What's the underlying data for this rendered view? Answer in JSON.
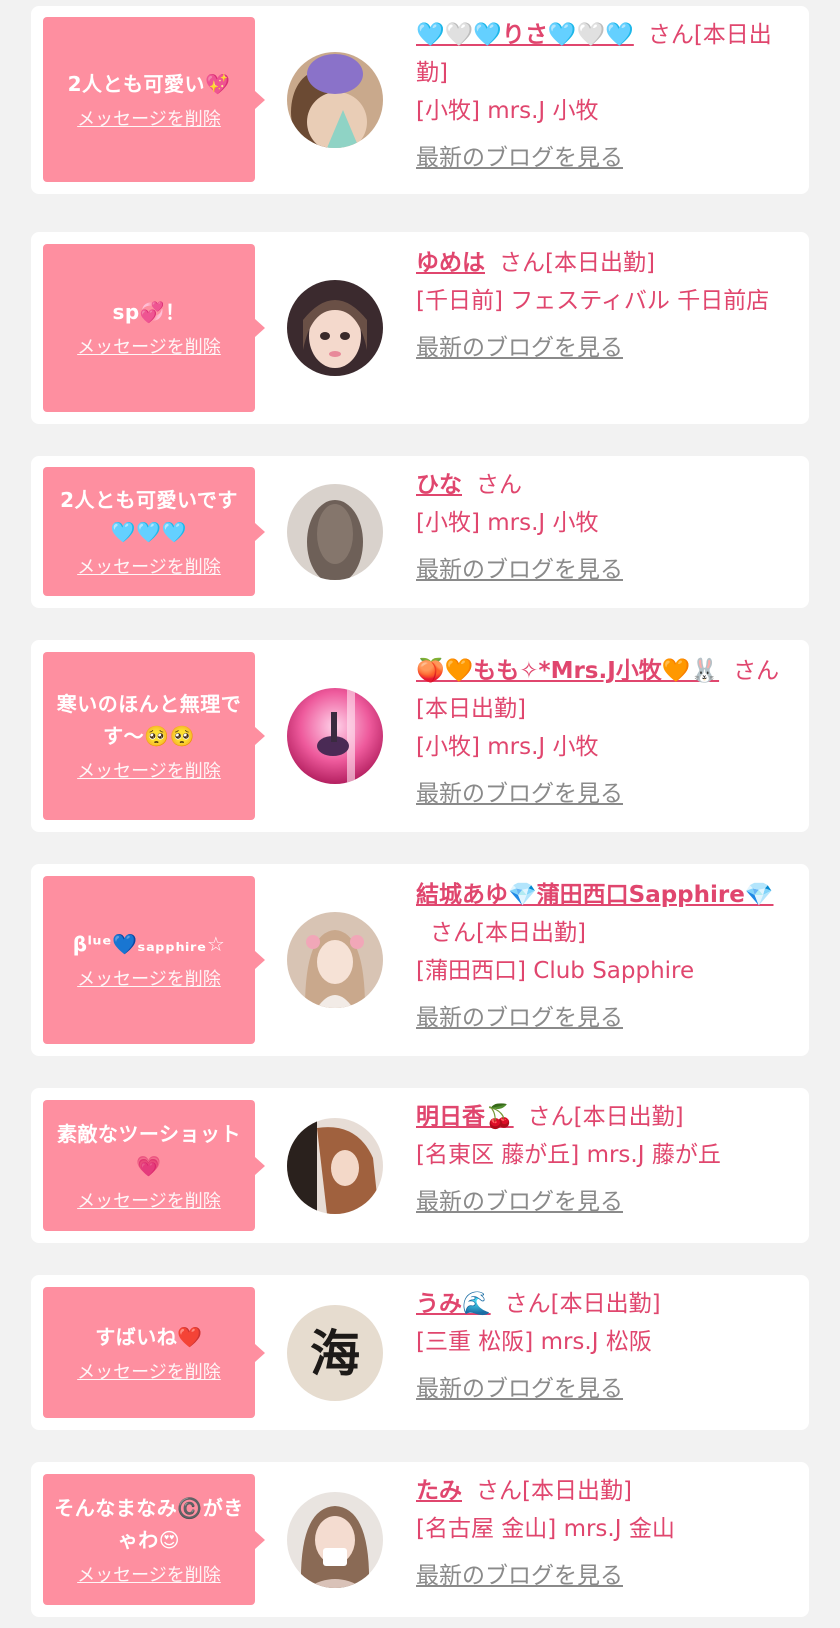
{
  "posts": [
    {
      "message": "2人とも可愛い💖",
      "delete_label": "メッセージを削除",
      "avatar": "avatar-photo-woman",
      "name": "🩵🤍🩵りさ🩵🤍🩵",
      "suffix": "さん[本日出勤]",
      "shop": "[小牧] mrs.J 小牧",
      "blog_label": "最新のブログを見る"
    },
    {
      "message": "sp💞！",
      "delete_label": "メッセージを削除",
      "avatar": "avatar-photo-woman",
      "name": "ゆめは",
      "suffix": "さん[本日出勤]",
      "shop": "[千日前] フェスティバル 千日前店",
      "blog_label": "最新のブログを見る"
    },
    {
      "message": "2人とも可愛いです🩵🩵🩵",
      "delete_label": "メッセージを削除",
      "avatar": "avatar-photo-hair",
      "name": "ひな",
      "suffix": "さん",
      "shop": "[小牧] mrs.J 小牧",
      "blog_label": "最新のブログを見る"
    },
    {
      "message": "寒いのほんと無理です〜🥺🥺",
      "delete_label": "メッセージを削除",
      "avatar": "avatar-photo-pink",
      "name": "🍑🧡もも✧*Mrs.J小牧🧡🐰",
      "suffix": "さん[本日出勤]",
      "shop": "[小牧] mrs.J 小牧",
      "blog_label": "最新のブログを見る"
    },
    {
      "message": "βˡᵘᵉ💙ₛₐₚₚₕᵢᵣₑ☆",
      "delete_label": "メッセージを削除",
      "avatar": "avatar-photo-woman",
      "name": "結城あゆ💎蒲田西口Sapphire💎",
      "suffix": "さん[本日出勤]",
      "shop": "[蒲田西口] Club Sapphire",
      "blog_label": "最新のブログを見る"
    },
    {
      "message": "素敵なツーショット💗",
      "delete_label": "メッセージを削除",
      "avatar": "avatar-photo-woman",
      "name": "明日香🍒",
      "suffix": "さん[本日出勤]",
      "shop": "[名東区 藤が丘] mrs.J 藤が丘",
      "blog_label": "最新のブログを見る"
    },
    {
      "message": "すばいね❤️",
      "delete_label": "メッセージを削除",
      "avatar": "avatar-calligraphy",
      "avatar_text": "海",
      "name": "うみ🌊",
      "suffix": "さん[本日出勤]",
      "shop": "[三重 松阪] mrs.J 松阪",
      "blog_label": "最新のブログを見る"
    },
    {
      "message": "そんなまなみ©️がきゃわ😍",
      "delete_label": "メッセージを削除",
      "avatar": "avatar-photo-woman",
      "name": "たみ",
      "suffix": "さん[本日出勤]",
      "shop": "[名古屋 金山] mrs.J 金山",
      "blog_label": "最新のブログを見る"
    }
  ],
  "colors": {
    "background": "#f2f2f2",
    "card": "#ffffff",
    "bubble": "#fe8fa0",
    "accent_text": "#e0466e",
    "link_gray": "#8a8a8a"
  }
}
